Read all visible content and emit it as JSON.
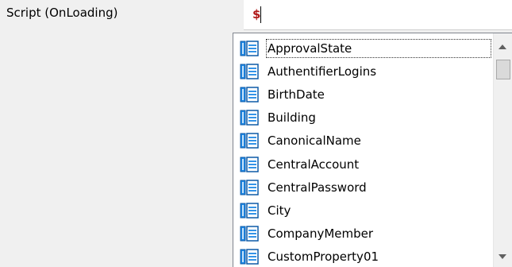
{
  "property": {
    "label": "Script (OnLoading)",
    "value": "$"
  },
  "dropdown": {
    "icon": "attribute-table-icon",
    "selected_index": 0,
    "items": [
      {
        "label": "ApprovalState"
      },
      {
        "label": "AuthentifierLogins"
      },
      {
        "label": "BirthDate"
      },
      {
        "label": "Building"
      },
      {
        "label": "CanonicalName"
      },
      {
        "label": "CentralAccount"
      },
      {
        "label": "CentralPassword"
      },
      {
        "label": "City"
      },
      {
        "label": "CompanyMember"
      },
      {
        "label": "CustomProperty01"
      }
    ]
  },
  "colors": {
    "value_text": "#b01818",
    "icon_blue": "#1e88e5",
    "background": "#f0f0f0"
  }
}
